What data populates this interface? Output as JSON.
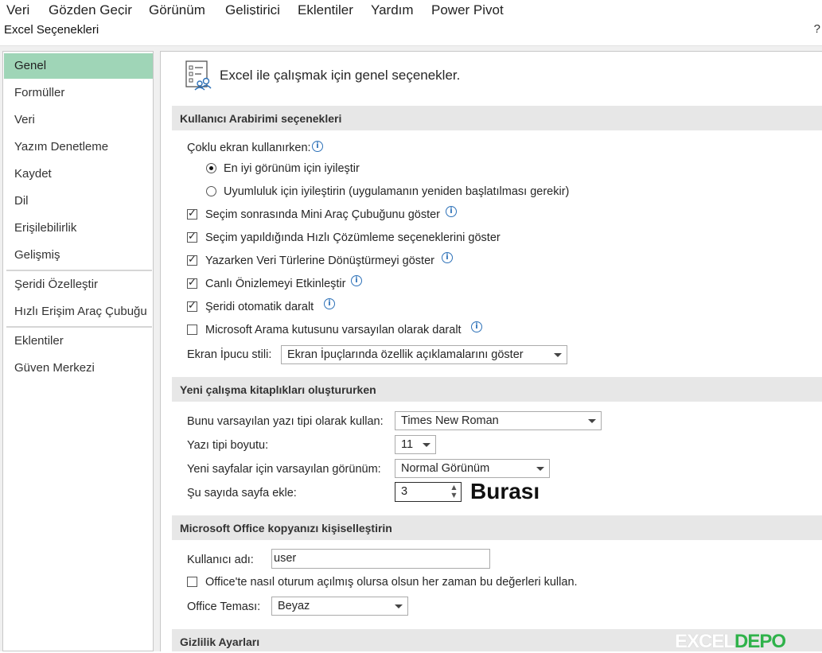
{
  "menu": [
    "Veri",
    "Gözden Geçir",
    "Görünüm",
    "Geliştirici",
    "Eklentiler",
    "Yardım",
    "Power Pivot"
  ],
  "window": {
    "title": "Excel Seçenekleri",
    "help": "?"
  },
  "sidebar": {
    "items": [
      {
        "label": "Genel"
      },
      {
        "label": "Formüller"
      },
      {
        "label": "Veri"
      },
      {
        "label": "Yazım Denetleme"
      },
      {
        "label": "Kaydet"
      },
      {
        "label": "Dil"
      },
      {
        "label": "Erişilebilirlik"
      },
      {
        "label": "Gelişmiş"
      },
      {
        "label": "Şeridi Özelleştir"
      },
      {
        "label": "Hızlı Erişim Araç Çubuğu"
      },
      {
        "label": "Eklentiler"
      },
      {
        "label": "Güven Merkezi"
      }
    ]
  },
  "main": {
    "title": "Excel ile çalışmak için genel seçenekler.",
    "ui_section": {
      "header": "Kullanıcı Arabirimi seçenekleri",
      "multi_screen_label": "Çoklu ekran kullanırken:",
      "radio_best": "En iyi görünüm için iyileştir",
      "radio_compat": "Uyumluluk için iyileştirin (uygulamanın yeniden başlatılması gerekir)",
      "cb_mini_toolbar": "Seçim sonrasında Mini Araç Çubuğunu göster",
      "cb_quick_analysis": "Seçim yapıldığında Hızlı Çözümleme seçeneklerini göster",
      "cb_data_types": "Yazarken Veri Türlerine Dönüştürmeyi göster",
      "cb_live_preview": "Canlı Önizlemeyi Etkinleştir",
      "cb_collapse_ribbon": "Şeridi otomatik daralt",
      "cb_search_box": "Microsoft Arama kutusunu varsayılan olarak daralt",
      "screentip_label": "Ekran İpucu stili:",
      "screentip_value": "Ekran İpuçlarında özellik açıklamalarını göster"
    },
    "workbook_section": {
      "header": "Yeni çalışma kitaplıkları oluştururken",
      "font_label": "Bunu varsayılan yazı tipi olarak kullan:",
      "font_value": "Times New Roman",
      "size_label": "Yazı tipi boyutu:",
      "size_value": "11",
      "view_label": "Yeni sayfalar için varsayılan görünüm:",
      "view_value": "Normal Görünüm",
      "sheets_label": "Şu sayıda sayfa ekle:",
      "sheets_value": "3",
      "annotation": "Burası"
    },
    "personalize_section": {
      "header": "Microsoft Office kopyanızı kişiselleştirin",
      "username_label": "Kullanıcı adı:",
      "username_value": "user",
      "always_use_label": "Office'te nasıl oturum açılmış olursa olsun her zaman bu değerleri kullan.",
      "theme_label": "Office Teması:",
      "theme_value": "Beyaz"
    },
    "privacy_section": {
      "header": "Gizlilik Ayarları"
    }
  },
  "watermark": {
    "part_a": "EXCEL",
    "part_b": "DEPO"
  }
}
